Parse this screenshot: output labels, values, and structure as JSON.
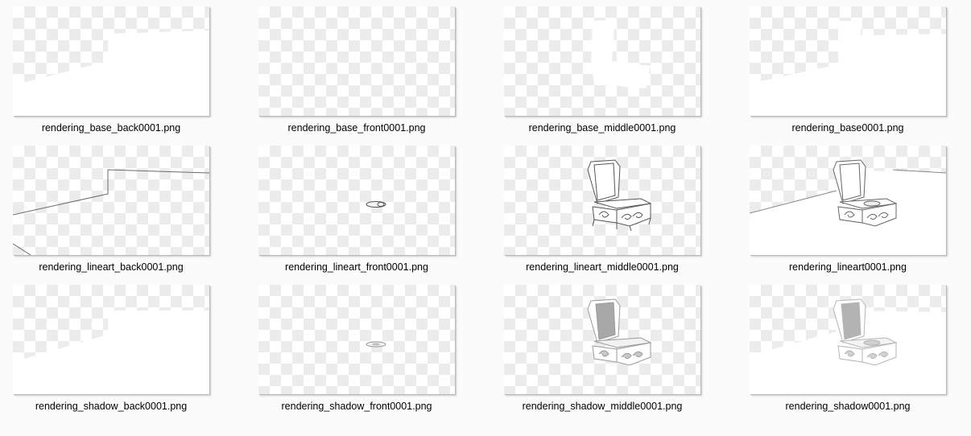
{
  "files": [
    {
      "name": "rendering_base_back0001.png"
    },
    {
      "name": "rendering_base_front0001.png"
    },
    {
      "name": "rendering_base_middle0001.png"
    },
    {
      "name": "rendering_base0001.png"
    },
    {
      "name": "rendering_lineart_back0001.png"
    },
    {
      "name": "rendering_lineart_front0001.png"
    },
    {
      "name": "rendering_lineart_middle0001.png"
    },
    {
      "name": "rendering_lineart0001.png"
    },
    {
      "name": "rendering_shadow_back0001.png"
    },
    {
      "name": "rendering_shadow_front0001.png"
    },
    {
      "name": "rendering_shadow_middle0001.png"
    },
    {
      "name": "rendering_shadow0001.png"
    }
  ],
  "icons": {
    "thumbnail": "image-thumbnail-icon"
  }
}
